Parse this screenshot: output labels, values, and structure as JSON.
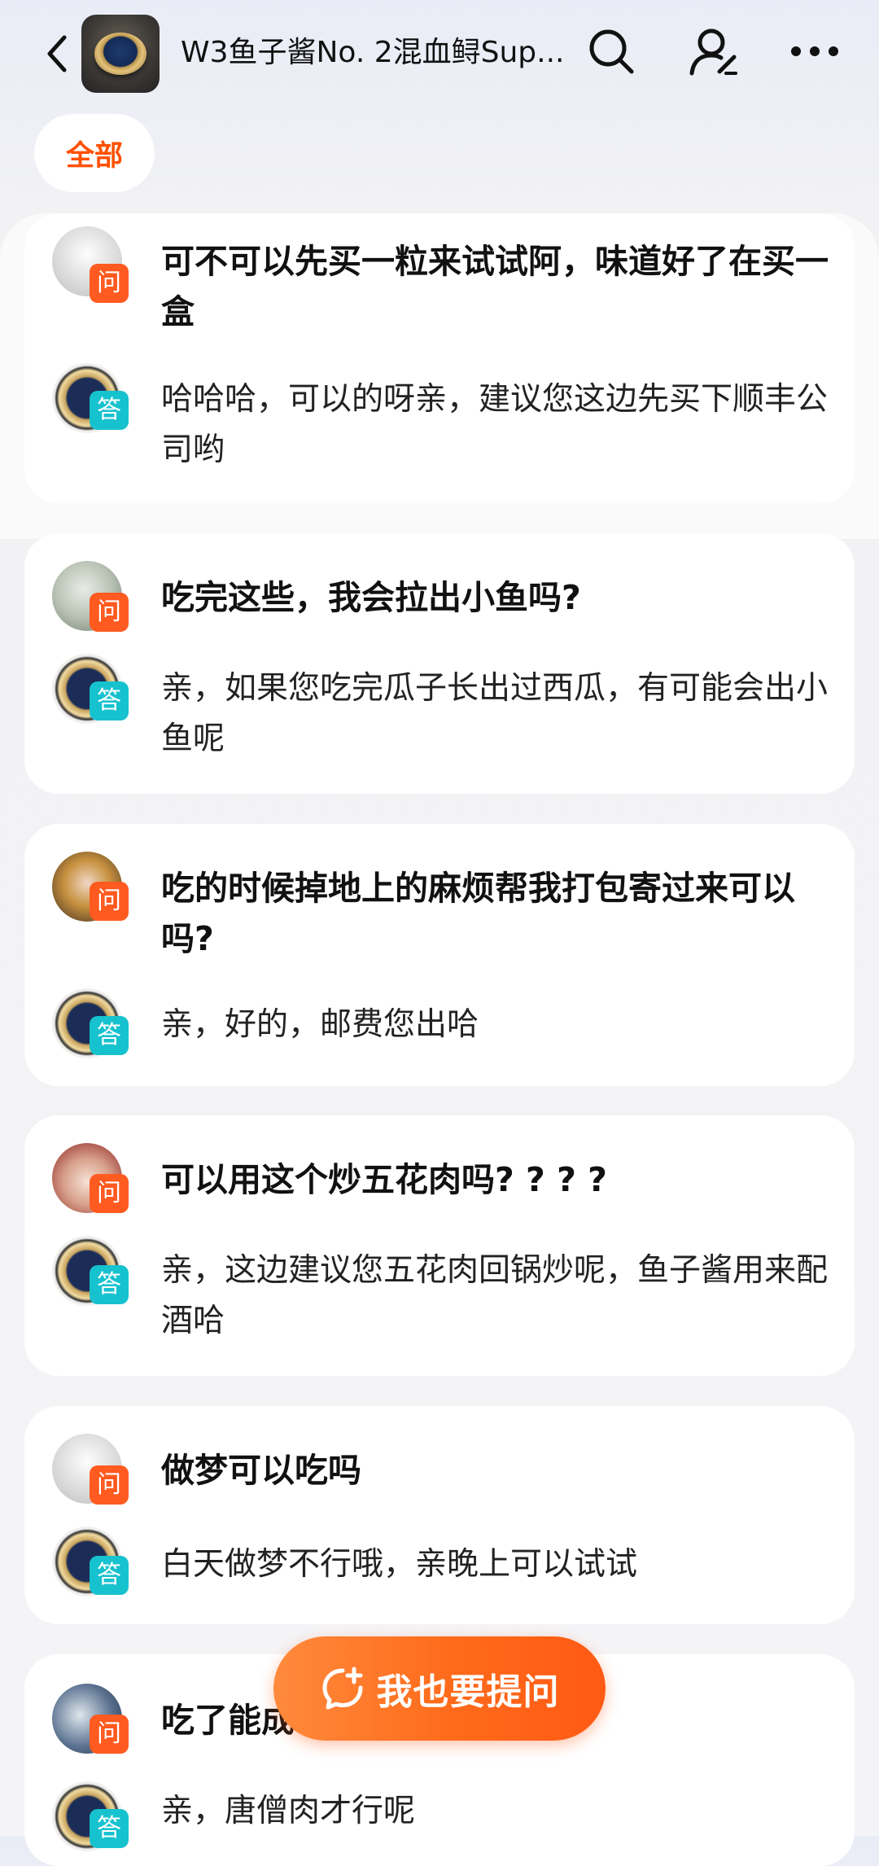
{
  "header": {
    "title": "W3鱼子酱No. 2混血鲟Sup..."
  },
  "filter": {
    "all_label": "全部"
  },
  "badges": {
    "ask": "问",
    "answer": "答"
  },
  "qa_items": [
    {
      "question": "可不可以先买一粒来试试阿，味道好了在买一盒",
      "answer": "哈哈哈，可以的呀亲，建议您这边先买下顺丰公司哟"
    },
    {
      "question": "吃完这些，我会拉出小鱼吗?",
      "answer": "亲，如果您吃完瓜子长出过西瓜，有可能会出小鱼呢"
    },
    {
      "question": "吃的时候掉地上的麻烦帮我打包寄过来可以吗?",
      "answer": "亲，好的，邮费您出哈"
    },
    {
      "question": "可以用这个炒五花肉吗? ? ? ?",
      "answer": "亲，这边建议您五花肉回锅炒呢，鱼子酱用来配酒哈"
    },
    {
      "question": "做梦可以吃吗",
      "answer": "白天做梦不行哦，亲晚上可以试试"
    },
    {
      "question": "吃了能成",
      "answer": "亲，唐僧肉才行呢"
    }
  ],
  "fab": {
    "label": "我也要提问"
  },
  "colors": {
    "brand_orange": "#ff5000",
    "ask_badge": "#ff5a1f",
    "answer_badge": "#17c2cf"
  },
  "icons": [
    "back-arrow-icon",
    "search-icon",
    "user-edit-icon",
    "more-icon",
    "chat-plus-icon"
  ]
}
